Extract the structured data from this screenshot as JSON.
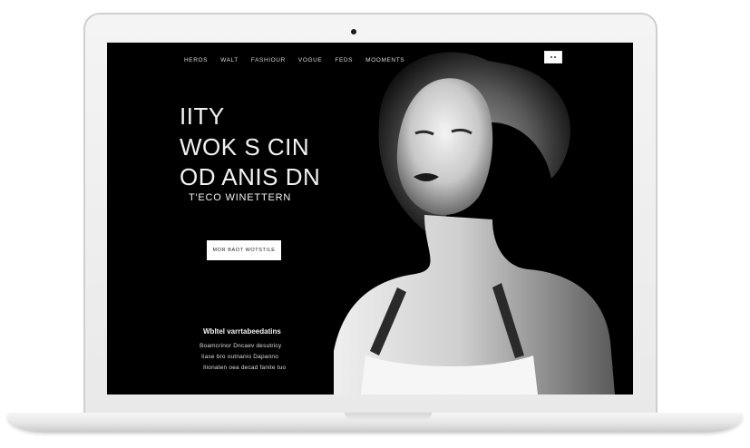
{
  "nav": {
    "items": [
      "HEROS",
      "WALT",
      "FASHIOUR",
      "VOGUE",
      "FEDS",
      "MOOMENTS"
    ]
  },
  "hero": {
    "line1": "IITY",
    "line2": "WOK S CIN",
    "line3": "OD ANIS DN",
    "subtitle": "T'ECO WINETTERN",
    "cta_label": "MOR BAOT WOTSTILE"
  },
  "footer": {
    "title": "Wbltel varrtabeedatins",
    "line1": "Boamcrinor Dncaev desutricy",
    "line2": "Iiase bro outnanio Dapanno",
    "line3": "Ilionaten oea decad fanite tuo"
  },
  "colors": {
    "screen_bg": "#000000",
    "text": "#f2f2f2",
    "bezel": "#ececec"
  }
}
